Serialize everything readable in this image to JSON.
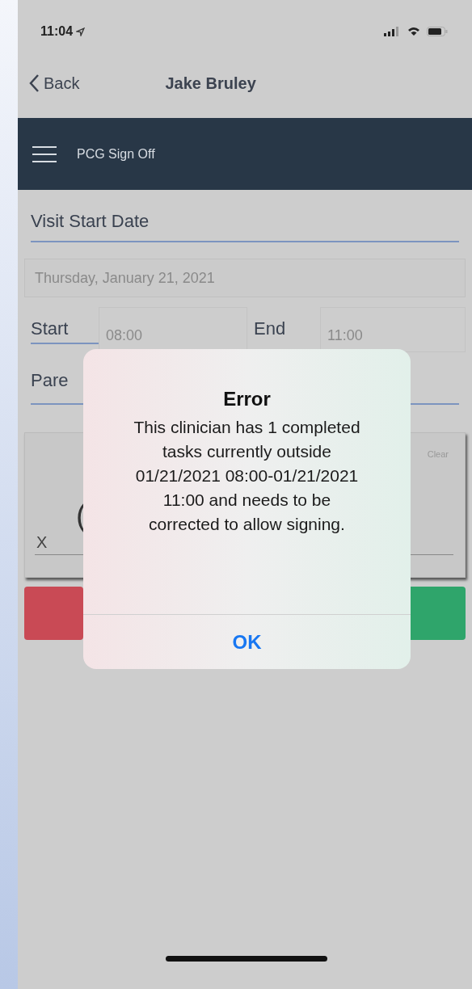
{
  "status_bar": {
    "time": "11:04"
  },
  "nav": {
    "back": "Back",
    "title": "Jake Bruley"
  },
  "header": {
    "title": "PCG Sign Off"
  },
  "form": {
    "date_label": "Visit Start Date",
    "date_value": "Thursday, January 21, 2021",
    "start_label": "Start",
    "start_value": "08:00",
    "end_label": "End",
    "end_value": "11:00",
    "field_label": "Pare"
  },
  "signature": {
    "clear": "Clear",
    "mark": "(",
    "x": "X"
  },
  "buttons": [
    {
      "color": "#c94a55"
    },
    {
      "color": "#2fa56b"
    }
  ],
  "alert": {
    "title": "Error",
    "message": "This clinician has 1 completed tasks currently outside 01/21/2021 08:00-01/21/2021 11:00 and needs to be corrected to allow signing.",
    "button": "OK"
  }
}
